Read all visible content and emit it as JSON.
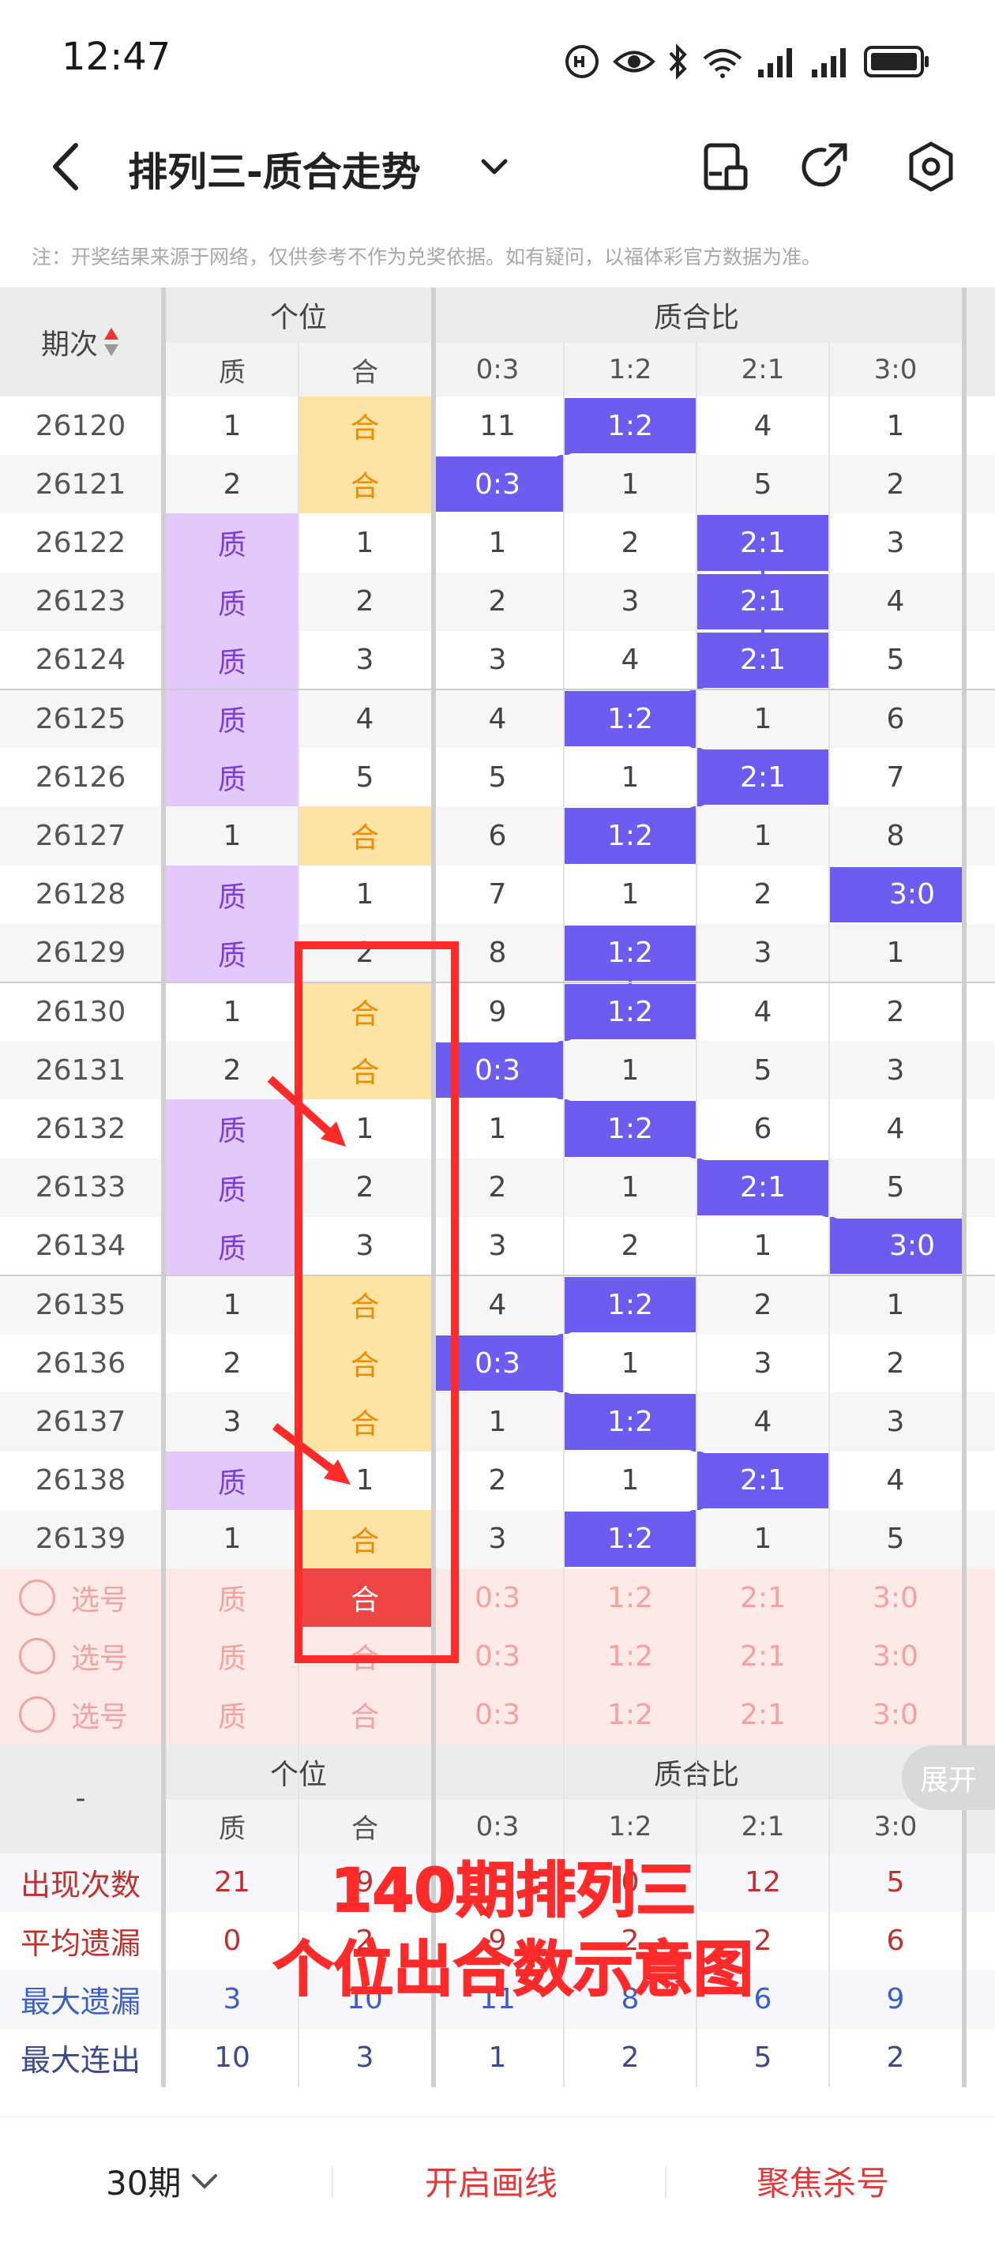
{
  "status": {
    "time": "12:47"
  },
  "header": {
    "title": "排列三-质合走势"
  },
  "notice": "注：开奖结果来源于网络，仅供参考不作为兑奖依据。如有疑问，以福体彩官方数据为准。",
  "columns": {
    "issue": "期次",
    "group1": "个位",
    "group2": "质合比",
    "sub": [
      "质",
      "合",
      "0:3",
      "1:2",
      "2:1",
      "3:0"
    ]
  },
  "rows": [
    {
      "issue": "26120",
      "zhi": "1",
      "he": "合",
      "hit": "he",
      "r": [
        "11",
        "1:2",
        "4",
        "1"
      ],
      "rhit": 1
    },
    {
      "issue": "26121",
      "zhi": "2",
      "he": "合",
      "hit": "he",
      "r": [
        "0:3",
        "1",
        "5",
        "2"
      ],
      "rhit": 0
    },
    {
      "issue": "26122",
      "zhi": "质",
      "he": "1",
      "hit": "zhi",
      "r": [
        "1",
        "2",
        "2:1",
        "3"
      ],
      "rhit": 2
    },
    {
      "issue": "26123",
      "zhi": "质",
      "he": "2",
      "hit": "zhi",
      "r": [
        "2",
        "3",
        "2:1",
        "4"
      ],
      "rhit": 2
    },
    {
      "issue": "26124",
      "zhi": "质",
      "he": "3",
      "hit": "zhi",
      "r": [
        "3",
        "4",
        "2:1",
        "5"
      ],
      "rhit": 2
    },
    {
      "issue": "26125",
      "zhi": "质",
      "he": "4",
      "hit": "zhi",
      "r": [
        "4",
        "1:2",
        "1",
        "6"
      ],
      "rhit": 1
    },
    {
      "issue": "26126",
      "zhi": "质",
      "he": "5",
      "hit": "zhi",
      "r": [
        "5",
        "1",
        "2:1",
        "7"
      ],
      "rhit": 2
    },
    {
      "issue": "26127",
      "zhi": "1",
      "he": "合",
      "hit": "he",
      "r": [
        "6",
        "1:2",
        "1",
        "8"
      ],
      "rhit": 1
    },
    {
      "issue": "26128",
      "zhi": "质",
      "he": "1",
      "hit": "zhi",
      "r": [
        "7",
        "1",
        "2",
        "3:0"
      ],
      "rhit": 3
    },
    {
      "issue": "26129",
      "zhi": "质",
      "he": "2",
      "hit": "zhi",
      "r": [
        "8",
        "1:2",
        "3",
        "1"
      ],
      "rhit": 1
    },
    {
      "issue": "26130",
      "zhi": "1",
      "he": "合",
      "hit": "he",
      "r": [
        "9",
        "1:2",
        "4",
        "2"
      ],
      "rhit": 1
    },
    {
      "issue": "26131",
      "zhi": "2",
      "he": "合",
      "hit": "he",
      "r": [
        "0:3",
        "1",
        "5",
        "3"
      ],
      "rhit": 0
    },
    {
      "issue": "26132",
      "zhi": "质",
      "he": "1",
      "hit": "zhi",
      "r": [
        "1",
        "1:2",
        "6",
        "4"
      ],
      "rhit": 1
    },
    {
      "issue": "26133",
      "zhi": "质",
      "he": "2",
      "hit": "zhi",
      "r": [
        "2",
        "1",
        "2:1",
        "5"
      ],
      "rhit": 2
    },
    {
      "issue": "26134",
      "zhi": "质",
      "he": "3",
      "hit": "zhi",
      "r": [
        "3",
        "2",
        "1",
        "3:0"
      ],
      "rhit": 3
    },
    {
      "issue": "26135",
      "zhi": "1",
      "he": "合",
      "hit": "he",
      "r": [
        "4",
        "1:2",
        "2",
        "1"
      ],
      "rhit": 1
    },
    {
      "issue": "26136",
      "zhi": "2",
      "he": "合",
      "hit": "he",
      "r": [
        "0:3",
        "1",
        "3",
        "2"
      ],
      "rhit": 0
    },
    {
      "issue": "26137",
      "zhi": "3",
      "he": "合",
      "hit": "he",
      "r": [
        "1",
        "1:2",
        "4",
        "3"
      ],
      "rhit": 1
    },
    {
      "issue": "26138",
      "zhi": "质",
      "he": "1",
      "hit": "zhi",
      "r": [
        "2",
        "1",
        "2:1",
        "4"
      ],
      "rhit": 2
    },
    {
      "issue": "26139",
      "zhi": "1",
      "he": "合",
      "hit": "he",
      "r": [
        "3",
        "1:2",
        "1",
        "5"
      ],
      "rhit": 1
    }
  ],
  "select_rows": [
    {
      "label": "选号",
      "cells": [
        "质",
        "合",
        "0:3",
        "1:2",
        "2:1",
        "3:0"
      ],
      "active": 1
    },
    {
      "label": "选号",
      "cells": [
        "质",
        "合",
        "0:3",
        "1:2",
        "2:1",
        "3:0"
      ],
      "active": -1
    },
    {
      "label": "选号",
      "cells": [
        "质",
        "合",
        "0:3",
        "1:2",
        "2:1",
        "3:0"
      ],
      "active": -1
    }
  ],
  "footer_header": {
    "dash": "-"
  },
  "expand_label": "展开",
  "stats": [
    {
      "label": "出现次数",
      "color": "#c0302f",
      "vals": [
        "21",
        "9",
        "",
        "0",
        "12",
        "5"
      ]
    },
    {
      "label": "平均遗漏",
      "color": "#c0302f",
      "vals": [
        "0",
        "2",
        "9",
        "2",
        "2",
        "6"
      ]
    },
    {
      "label": "最大遗漏",
      "color": "#3b5fc6",
      "vals": [
        "3",
        "10",
        "11",
        "8",
        "6",
        "9"
      ]
    },
    {
      "label": "最大连出",
      "color": "#3b4a8c",
      "vals": [
        "10",
        "3",
        "1",
        "2",
        "5",
        "2"
      ]
    }
  ],
  "overlay": {
    "line1": "140期排列三",
    "line2": "个位出合数示意图"
  },
  "bottom": {
    "period": "30期",
    "draw": "开启画线",
    "focus": "聚焦杀号"
  },
  "colors": {
    "accent": "#6c5cf0",
    "zhi_bg": "#e3c8fb",
    "he_bg": "#fde3a4",
    "red": "#ff2a2a"
  }
}
